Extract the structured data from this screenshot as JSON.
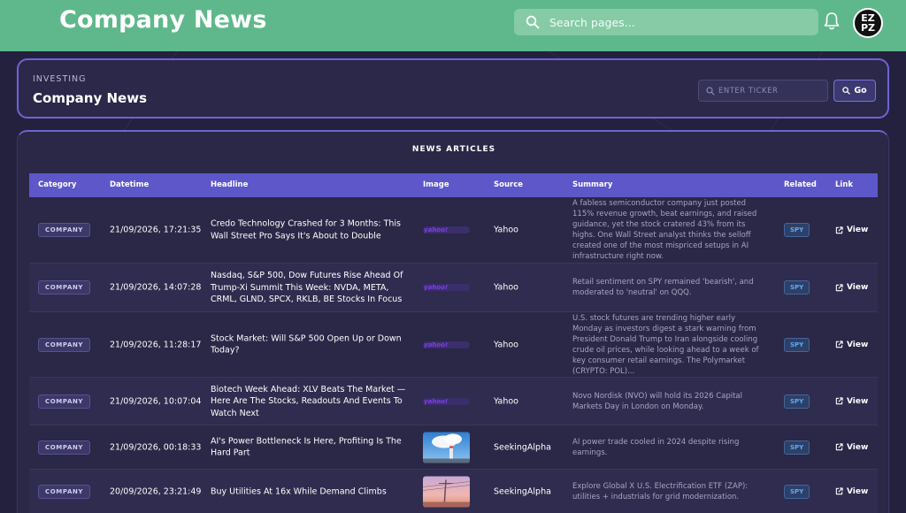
{
  "header": {
    "title": "Company News",
    "search_placeholder": "Search pages...",
    "avatar_text_top": "EZ",
    "avatar_text_bottom": "PZ"
  },
  "card": {
    "eyebrow": "INVESTING",
    "title": "Company News",
    "ticker_placeholder": "ENTER TICKER",
    "go_label": "Go"
  },
  "panel": {
    "title": "NEWS ARTICLES",
    "columns": [
      "Category",
      "Datetime",
      "Headline",
      "Image",
      "Source",
      "Summary",
      "Related",
      "Link"
    ]
  },
  "rows": [
    {
      "category": "COMPANY",
      "datetime": "21/09/2026, 17:21:35",
      "headline": "Credo Technology Crashed for 3 Months: This Wall Street Pro Says It's About to Double",
      "image": "yahoo-logo",
      "image_text": "yahoo!",
      "source": "Yahoo",
      "summary": "A fabless semiconductor company just posted 115% revenue growth, beat earnings, and raised guidance, yet the stock cratered 43% from its highs. One Wall Street analyst thinks the selloff created one of the most mispriced setups in AI infrastructure right now.",
      "related": "SPY",
      "link": "View"
    },
    {
      "category": "COMPANY",
      "datetime": "21/09/2026, 14:07:28",
      "headline": "Nasdaq, S&P 500, Dow Futures Rise Ahead Of Trump-Xi Summit This Week: NVDA, META, CRML, GLND, SPCX, RKLB, BE Stocks In Focus",
      "image": "yahoo-logo",
      "image_text": "yahoo!",
      "source": "Yahoo",
      "summary": "Retail sentiment on SPY remained 'bearish', and moderated to 'neutral' on QQQ.",
      "related": "SPY",
      "link": "View"
    },
    {
      "category": "COMPANY",
      "datetime": "21/09/2026, 11:28:17",
      "headline": "Stock Market: Will S&P 500 Open Up or Down Today?",
      "image": "yahoo-logo",
      "image_text": "yahoo!",
      "source": "Yahoo",
      "summary": "U.S. stock futures are trending higher early Monday as investors digest a stark warning from President Donald Trump to Iran alongside cooling crude oil prices, while looking ahead to a week of key consumer retail earnings. The Polymarket (CRYPTO: POL)...",
      "related": "SPY",
      "link": "View"
    },
    {
      "category": "COMPANY",
      "datetime": "21/09/2026, 10:07:04",
      "headline": "Biotech Week Ahead: XLV Beats The Market — Here Are The Stocks, Readouts And Events To Watch Next",
      "image": "yahoo-logo",
      "image_text": "yahoo!",
      "source": "Yahoo",
      "summary": "Novo Nordisk (NVO) will hold its 2026 Capital Markets Day in London on Monday.",
      "related": "SPY",
      "link": "View"
    },
    {
      "category": "COMPANY",
      "datetime": "21/09/2026, 00:18:33",
      "headline": "AI's Power Bottleneck Is Here, Profiting Is The Hard Part",
      "image": "photo-smokestack",
      "image_text": "",
      "source": "SeekingAlpha",
      "summary": "AI power trade cooled in 2024 despite rising earnings.",
      "related": "SPY",
      "link": "View"
    },
    {
      "category": "COMPANY",
      "datetime": "20/09/2026, 23:21:49",
      "headline": "Buy Utilities At 16x While Demand Climbs",
      "image": "photo-power-lines",
      "image_text": "",
      "source": "SeekingAlpha",
      "summary": "Explore Global X U.S. Electrification ETF (ZAP): utilities + industrials for grid modernization.",
      "related": "SPY",
      "link": "View"
    }
  ],
  "colors": {
    "header_bg": "#5fb88b",
    "page_bg": "#24213f",
    "accent": "#6d65d4",
    "table_header": "#5d57c9",
    "related_text": "#5aa9ff"
  }
}
